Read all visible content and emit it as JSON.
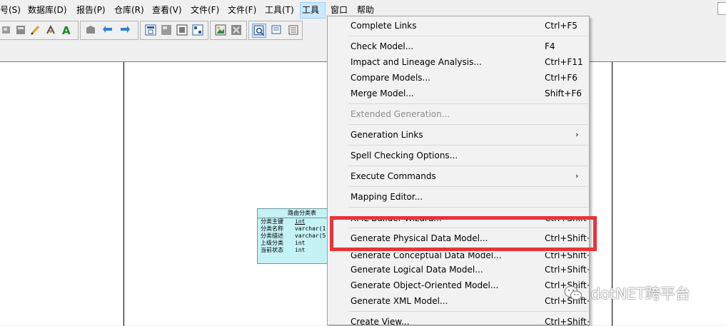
{
  "menubar": {
    "items": [
      "号(S)",
      "数据库(D)",
      "报告(P)",
      "仓库(R)",
      "查看(V)",
      "文件(F)",
      "文件(F)",
      "工具(T)",
      "工具",
      "窗口",
      "帮助"
    ],
    "active_index": 8
  },
  "tools_menu": {
    "items": [
      {
        "label": "Complete Links",
        "shortcut": "Ctrl+F5"
      },
      {
        "label": "Check Model...",
        "shortcut": "F4"
      },
      {
        "label": "Impact and Lineage Analysis...",
        "shortcut": "Ctrl+F11"
      },
      {
        "label": "Compare Models...",
        "shortcut": "Ctrl+F6"
      },
      {
        "label": "Merge Model...",
        "shortcut": "Shift+F6"
      },
      {
        "label": "Extended Generation...",
        "shortcut": ""
      },
      {
        "label": "Generation Links",
        "shortcut": "",
        "submenu_arrow": "›"
      },
      {
        "label": "Spell Checking Options...",
        "shortcut": ""
      },
      {
        "label": "Execute Commands",
        "shortcut": "",
        "submenu_arrow": "›"
      },
      {
        "label": "Mapping Editor...",
        "shortcut": ""
      },
      {
        "label": "XML Builder Wizard...",
        "shortcut": "Ctrl+Shift+W"
      },
      {
        "label": "Generate Physical Data Model...",
        "shortcut": "Ctrl+Shift+P"
      },
      {
        "label": "Generate Conceptual Data Model...",
        "shortcut": "Ctrl+Shift+C"
      },
      {
        "label": "Generate Logical Data Model...",
        "shortcut": "Ctrl+Shift+L"
      },
      {
        "label": "Generate Object-Oriented Model...",
        "shortcut": "Ctrl+Shift+O"
      },
      {
        "label": "Generate XML Model...",
        "shortcut": "Ctrl+Shift+M"
      },
      {
        "label": "Create View...",
        "shortcut": "Ctrl+Shift+V"
      }
    ],
    "disabled_item": "Extended Generation...",
    "highlighted_item": "Generate Physical Data Model...",
    "highlight_color": "#e8333a"
  },
  "entity": {
    "title": "路由分类表",
    "rows": [
      {
        "name": "分类主键",
        "type": "int"
      },
      {
        "name": "分类名称",
        "type": "varchar(1"
      },
      {
        "name": "分类描述",
        "type": "varchar(5"
      },
      {
        "name": "上级分类",
        "type": "int"
      },
      {
        "name": "当前状态",
        "type": "int"
      }
    ],
    "fill_color": "#c5f2f5"
  },
  "watermark": {
    "text": "dotNET跨平台",
    "icon": "wechat-icon"
  },
  "toolbar": {
    "icons": [
      "tool-icon-1",
      "tool-icon-2",
      "pencil-icon",
      "arrow-tool-icon",
      "text-a-icon",
      "package-icon",
      "link-left-icon",
      "link-right-icon",
      "table-icon",
      "view-icon",
      "reference-icon",
      "association-icon",
      "image-icon",
      "proc-icon",
      "zoom-icon",
      "note-icon",
      "list-icon"
    ]
  }
}
